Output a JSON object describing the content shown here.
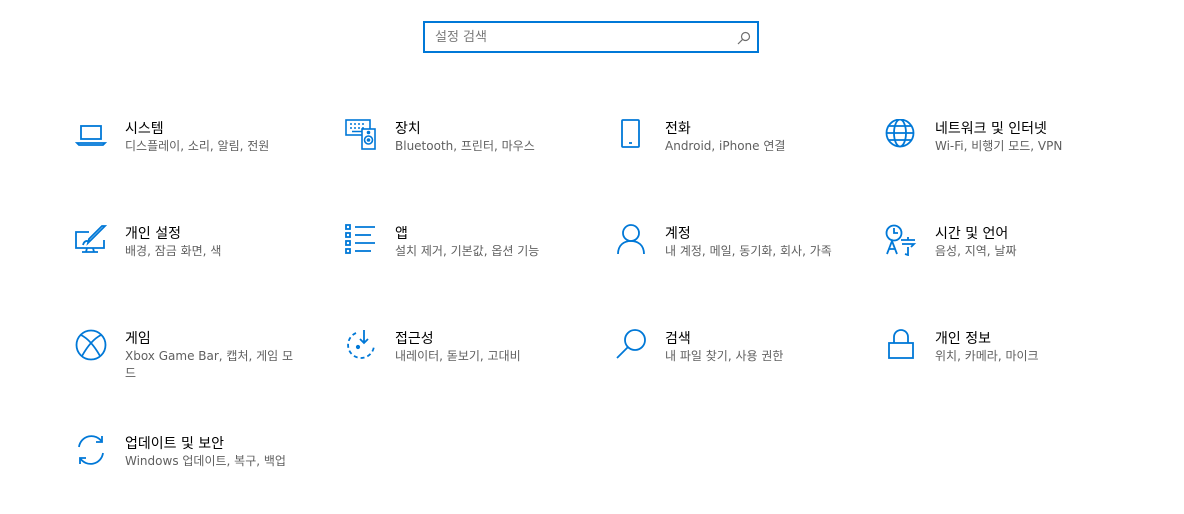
{
  "search": {
    "placeholder": "설정 검색"
  },
  "accent": "#0078d7",
  "tiles": [
    {
      "icon": "laptop-icon",
      "title": "시스템",
      "desc": "디스플레이, 소리, 알림, 전원"
    },
    {
      "icon": "devices-icon",
      "title": "장치",
      "desc": "Bluetooth, 프린터, 마우스"
    },
    {
      "icon": "phone-icon",
      "title": "전화",
      "desc": "Android, iPhone 연결"
    },
    {
      "icon": "globe-icon",
      "title": "네트워크 및 인터넷",
      "desc": "Wi-Fi, 비행기 모드, VPN"
    },
    {
      "icon": "personalization-icon",
      "title": "개인 설정",
      "desc": "배경, 잠금 화면, 색"
    },
    {
      "icon": "apps-list-icon",
      "title": "앱",
      "desc": "설치 제거, 기본값, 옵션 기능"
    },
    {
      "icon": "person-icon",
      "title": "계정",
      "desc": "내 계정, 메일, 동기화, 회사, 가족"
    },
    {
      "icon": "time-language-icon",
      "title": "시간 및 언어",
      "desc": "음성, 지역, 날짜"
    },
    {
      "icon": "xbox-icon",
      "title": "게임",
      "desc": "Xbox Game Bar, 캡처, 게임 모드"
    },
    {
      "icon": "ease-of-access-icon",
      "title": "접근성",
      "desc": "내레이터, 돋보기, 고대비"
    },
    {
      "icon": "search-icon",
      "title": "검색",
      "desc": "내 파일 찾기, 사용 권한"
    },
    {
      "icon": "lock-icon",
      "title": "개인 정보",
      "desc": "위치, 카메라, 마이크"
    },
    {
      "icon": "update-sync-icon",
      "title": "업데이트 및 보안",
      "desc": "Windows 업데이트, 복구, 백업"
    }
  ]
}
